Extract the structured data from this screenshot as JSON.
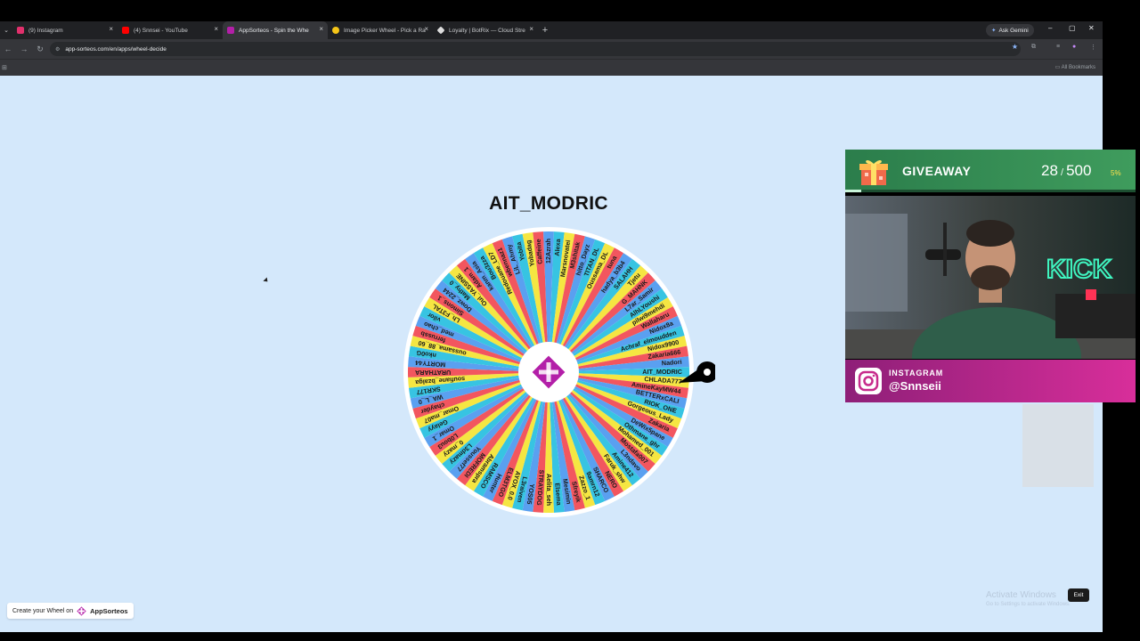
{
  "browser": {
    "tabs": [
      {
        "label": "(9) Instagram",
        "favicon_color": "#e1306c",
        "active": false
      },
      {
        "label": "(4) Snnsei - YouTube",
        "favicon_color": "#ff0000",
        "active": false
      },
      {
        "label": "AppSorteos - Spin the Whe",
        "favicon_color": "#b31fa8",
        "active": true
      },
      {
        "label": "Image Picker Wheel - Pick a Ra",
        "favicon_color": "#f5c518",
        "active": false
      },
      {
        "label": "Loyalty | BotRix — Cloud Stre",
        "favicon_color": "#dddddd",
        "active": false
      }
    ],
    "new_tab": "+",
    "ask_gemini": "Ask Gemini",
    "url": "app-sorteos.com/en/apps/wheel-decide",
    "all_bookmarks": "All Bookmarks"
  },
  "page": {
    "winner": "AIT_MODRIC",
    "create_badge": {
      "text": "Create your Wheel on",
      "brand": "AppSorteos"
    },
    "exit_label": "Exit",
    "watermark_title": "Activate Windows",
    "watermark_sub": "Go to Settings to activate Windows."
  },
  "wheel": {
    "pointer_color": "#000000",
    "segment_colors": [
      "#5aa0f0",
      "#37c4e2",
      "#f5e642",
      "#f2565f"
    ],
    "center_logo_color": "#b31fa8",
    "entries": [
      "Mesimin",
      "Elsema",
      "Aelita_seh",
      "STRAYDOG",
      "YOS05",
      "L3raiven",
      "AYOX_0.0",
      "ELM3TGO",
      "Hunter",
      "RAMSCO",
      "Abramspra",
      "MOFREDI",
      "Youssef77",
      "L3dmazy",
      "0_mazy",
      "L0bou3",
      "Omar_1",
      "Gelayy",
      "Omar_ma07",
      "chayder",
      "WA_L_0",
      "SKR177",
      "soufiane_bzalga",
      "URATHARA",
      "MORTY44",
      "nko0G",
      "oussama_88_60",
      "ferrussb",
      "med_chao",
      "vilor",
      "Lh_F3TAL",
      "Simons_1",
      "Dowz_2244",
      "Mathy_0",
      "Oul_YASSINE",
      "Adam_1",
      "kanm_Asia",
      "Bou3zza",
      "Redouane_LD7",
      "wbennaz1",
      "LiL_Ahmy",
      "Yobita",
      "Yobadag",
      "Caffeine",
      "12Azrah",
      "Alexa",
      "Marsnovatei",
      "M3shitak",
      "hitto_Dayz",
      "TITAN_DL",
      "Oussama_DL",
      "tuna",
      "hadya_b3b4",
      "SALAHH",
      "Tjetu",
      "G_MAHNK",
      "L7ar_Samir",
      "AlhLYoushi",
      "pilwi9mehdi",
      "Wallaharu",
      "Nidox8a",
      "Achraf_elmoudden",
      "Nidox9900",
      "Zakaria666",
      "Nadori",
      "AIT_MODRIC",
      "CHLADA777",
      "AmineKayMW44",
      "BETTERxCALI",
      "RIOK_ONE",
      "Gorgeous_Lady",
      "Zakaria",
      "DeWix5pane",
      "Othmane_ghr",
      "Mohamed_001",
      "Mostafa007",
      "L3ndavo",
      "Amine412",
      "Faruk_shw",
      "NERO",
      "SHARCO",
      "9amrn12",
      "Zazzo_1",
      "Sfreyik"
    ]
  },
  "giveaway": {
    "title": "GIVEAWAY",
    "current": "28",
    "separator": " / ",
    "total": "500",
    "percent_label": "5%",
    "progress": 0.056
  },
  "instagram": {
    "label": "INSTAGRAM",
    "handle": "@Snnseii"
  },
  "colors": {
    "page_bg": "#d4e8fb",
    "giveaway_green": "#3f9c5d",
    "instagram_pink": "#d82e9a"
  }
}
